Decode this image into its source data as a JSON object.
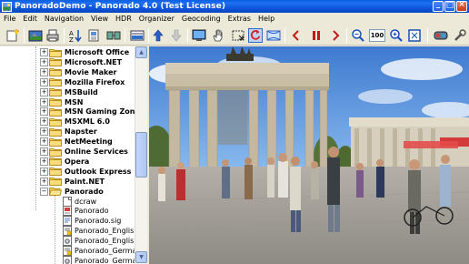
{
  "window": {
    "title": "PanoradoDemo  -  Panorado 4.0 (Test License)",
    "controls": {
      "minimize": "_",
      "maximize": "□",
      "close": "×"
    }
  },
  "menu": [
    "File",
    "Edit",
    "Navigation",
    "View",
    "HDR",
    "Organizer",
    "Geocoding",
    "Extras",
    "Help"
  ],
  "toolbar": {
    "zoom_value": "100",
    "buttons": [
      "new-window-icon",
      "photo-icon",
      "print-icon",
      "sort-icon",
      "image-list-icon",
      "panorama-icon",
      "arrow-up-icon",
      "arrow-down-icon",
      "screen-icon",
      "hand-icon",
      "rectangle-select-icon",
      "rotate-icon",
      "pan-view-icon",
      "previous-icon",
      "pause-icon",
      "next-icon",
      "zoom-in-icon",
      "zoom-out-icon",
      "fit-icon",
      "stereo-icon",
      "tools-icon"
    ]
  },
  "tree": {
    "folders": [
      "Microsoft Office",
      "Microsoft.NET",
      "Movie Maker",
      "Mozilla Firefox",
      "MSBuild",
      "MSN",
      "MSN Gaming Zone",
      "MSXML 6.0",
      "Napster",
      "NetMeeting",
      "Online Services",
      "Opera",
      "Outlook Express",
      "Paint.NET",
      "Panorado"
    ],
    "children": [
      "dcraw",
      "Panorado",
      "Panorado.sig",
      "Panorado_English",
      "Panorado_English.dll",
      "Panorado_German",
      "Panorado_German.dll"
    ],
    "selected": "PanoradoDemo"
  },
  "colors": {
    "title_bar": "#0a5fe0",
    "selection": "#316ac5",
    "folder": "#f5d66b"
  }
}
